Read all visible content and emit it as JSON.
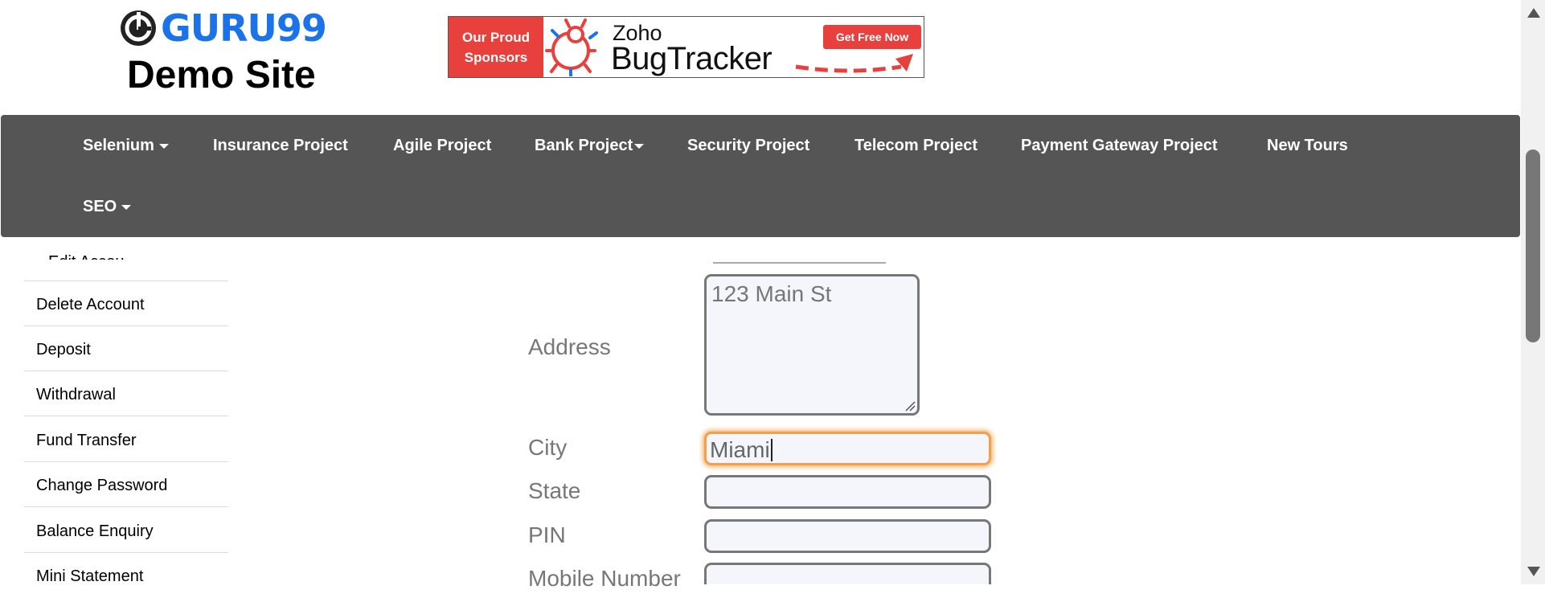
{
  "header": {
    "logo_text": "GURU99",
    "site_title": "Demo Site",
    "sponsor": {
      "line1": "Our Proud",
      "line2": "Sponsors",
      "brand_top": "Zoho",
      "brand_main": "BugTracker",
      "cta": "Get Free Now"
    }
  },
  "nav": {
    "items": [
      "Selenium",
      "Insurance Project",
      "Agile Project",
      "Bank Project",
      "Security Project",
      "Telecom Project",
      "Payment Gateway Project",
      "New Tours",
      "SEO"
    ]
  },
  "sidebar": {
    "partial_item": "Edit Account",
    "items": [
      "Delete Account",
      "Deposit",
      "Withdrawal",
      "Fund Transfer",
      "Change Password",
      "Balance Enquiry",
      "Mini Statement"
    ]
  },
  "form": {
    "address_label": "Address",
    "address_value": "123 Main St",
    "city_label": "City",
    "city_value": "Miami",
    "state_label": "State",
    "state_value": "",
    "pin_label": "PIN",
    "pin_value": "",
    "mobile_label": "Mobile Number",
    "mobile_value": ""
  },
  "colors": {
    "brand_blue": "#1a73e8",
    "navbar_bg": "#555555",
    "sponsor_red": "#e8403c",
    "focus_orange": "#f0a050"
  }
}
